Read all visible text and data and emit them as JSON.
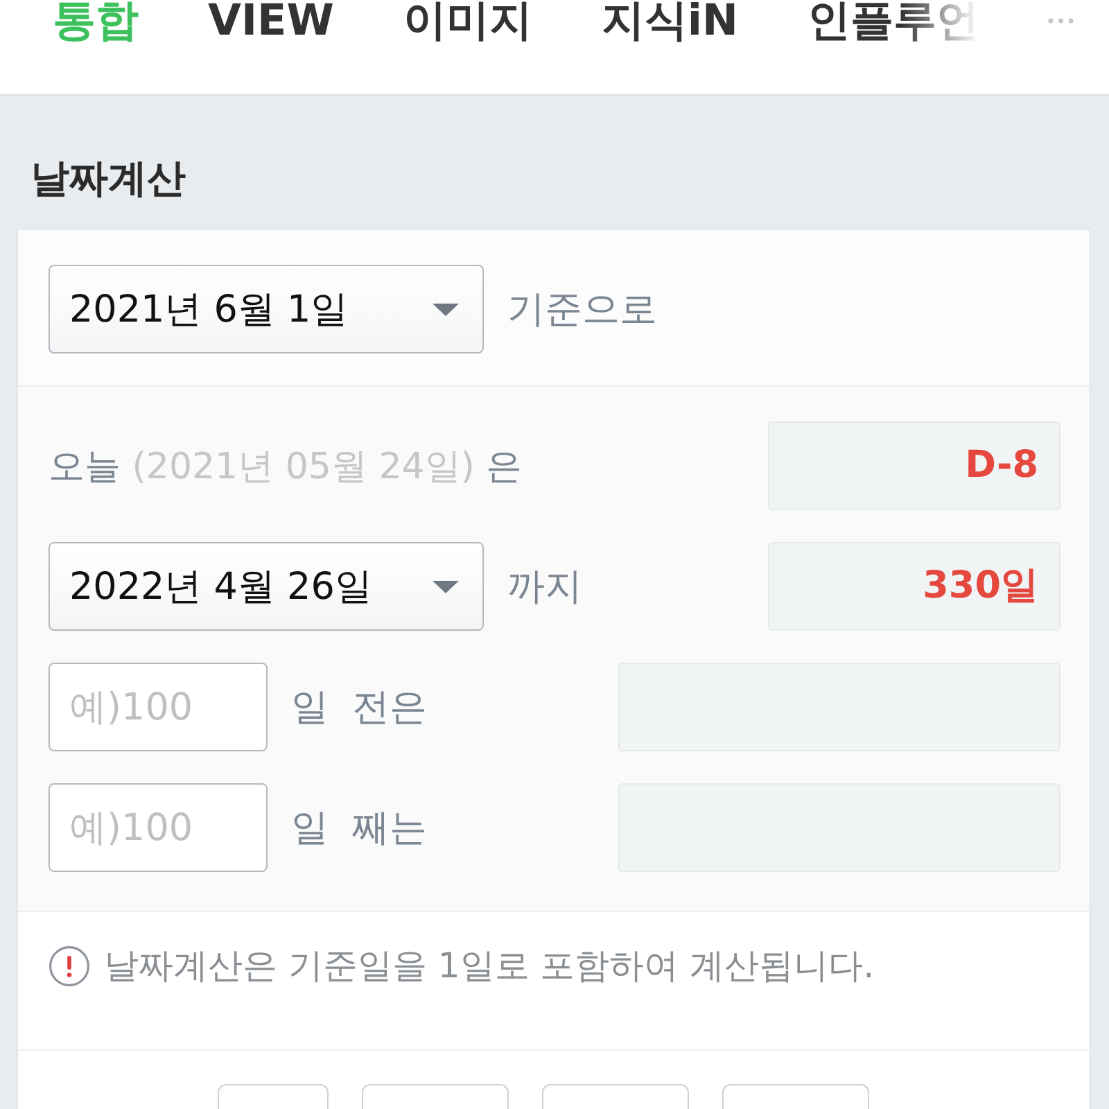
{
  "tabs": [
    {
      "label": "통합",
      "selected": true
    },
    {
      "label": "VIEW",
      "selected": false
    },
    {
      "label": "이미지",
      "selected": false
    },
    {
      "label": "지식iN",
      "selected": false
    },
    {
      "label": "인플루언",
      "selected": false,
      "faded": true
    }
  ],
  "title": "날짜계산",
  "base": {
    "date": "2021년 6월 1일",
    "label": "기준으로"
  },
  "today": {
    "prefix": "오늘",
    "date": "(2021년 05월 24일)",
    "suffix": "은",
    "result": "D-8"
  },
  "target": {
    "date": "2022년 4월 26일",
    "label": "까지",
    "result": "330일"
  },
  "offsets": [
    {
      "placeholder": "예)100",
      "unit": "일",
      "label": "전은"
    },
    {
      "placeholder": "예)100",
      "unit": "일",
      "label": "째는"
    }
  ],
  "notice": "날짜계산은 기준일을 1일로 포함하여 계산됩니다."
}
